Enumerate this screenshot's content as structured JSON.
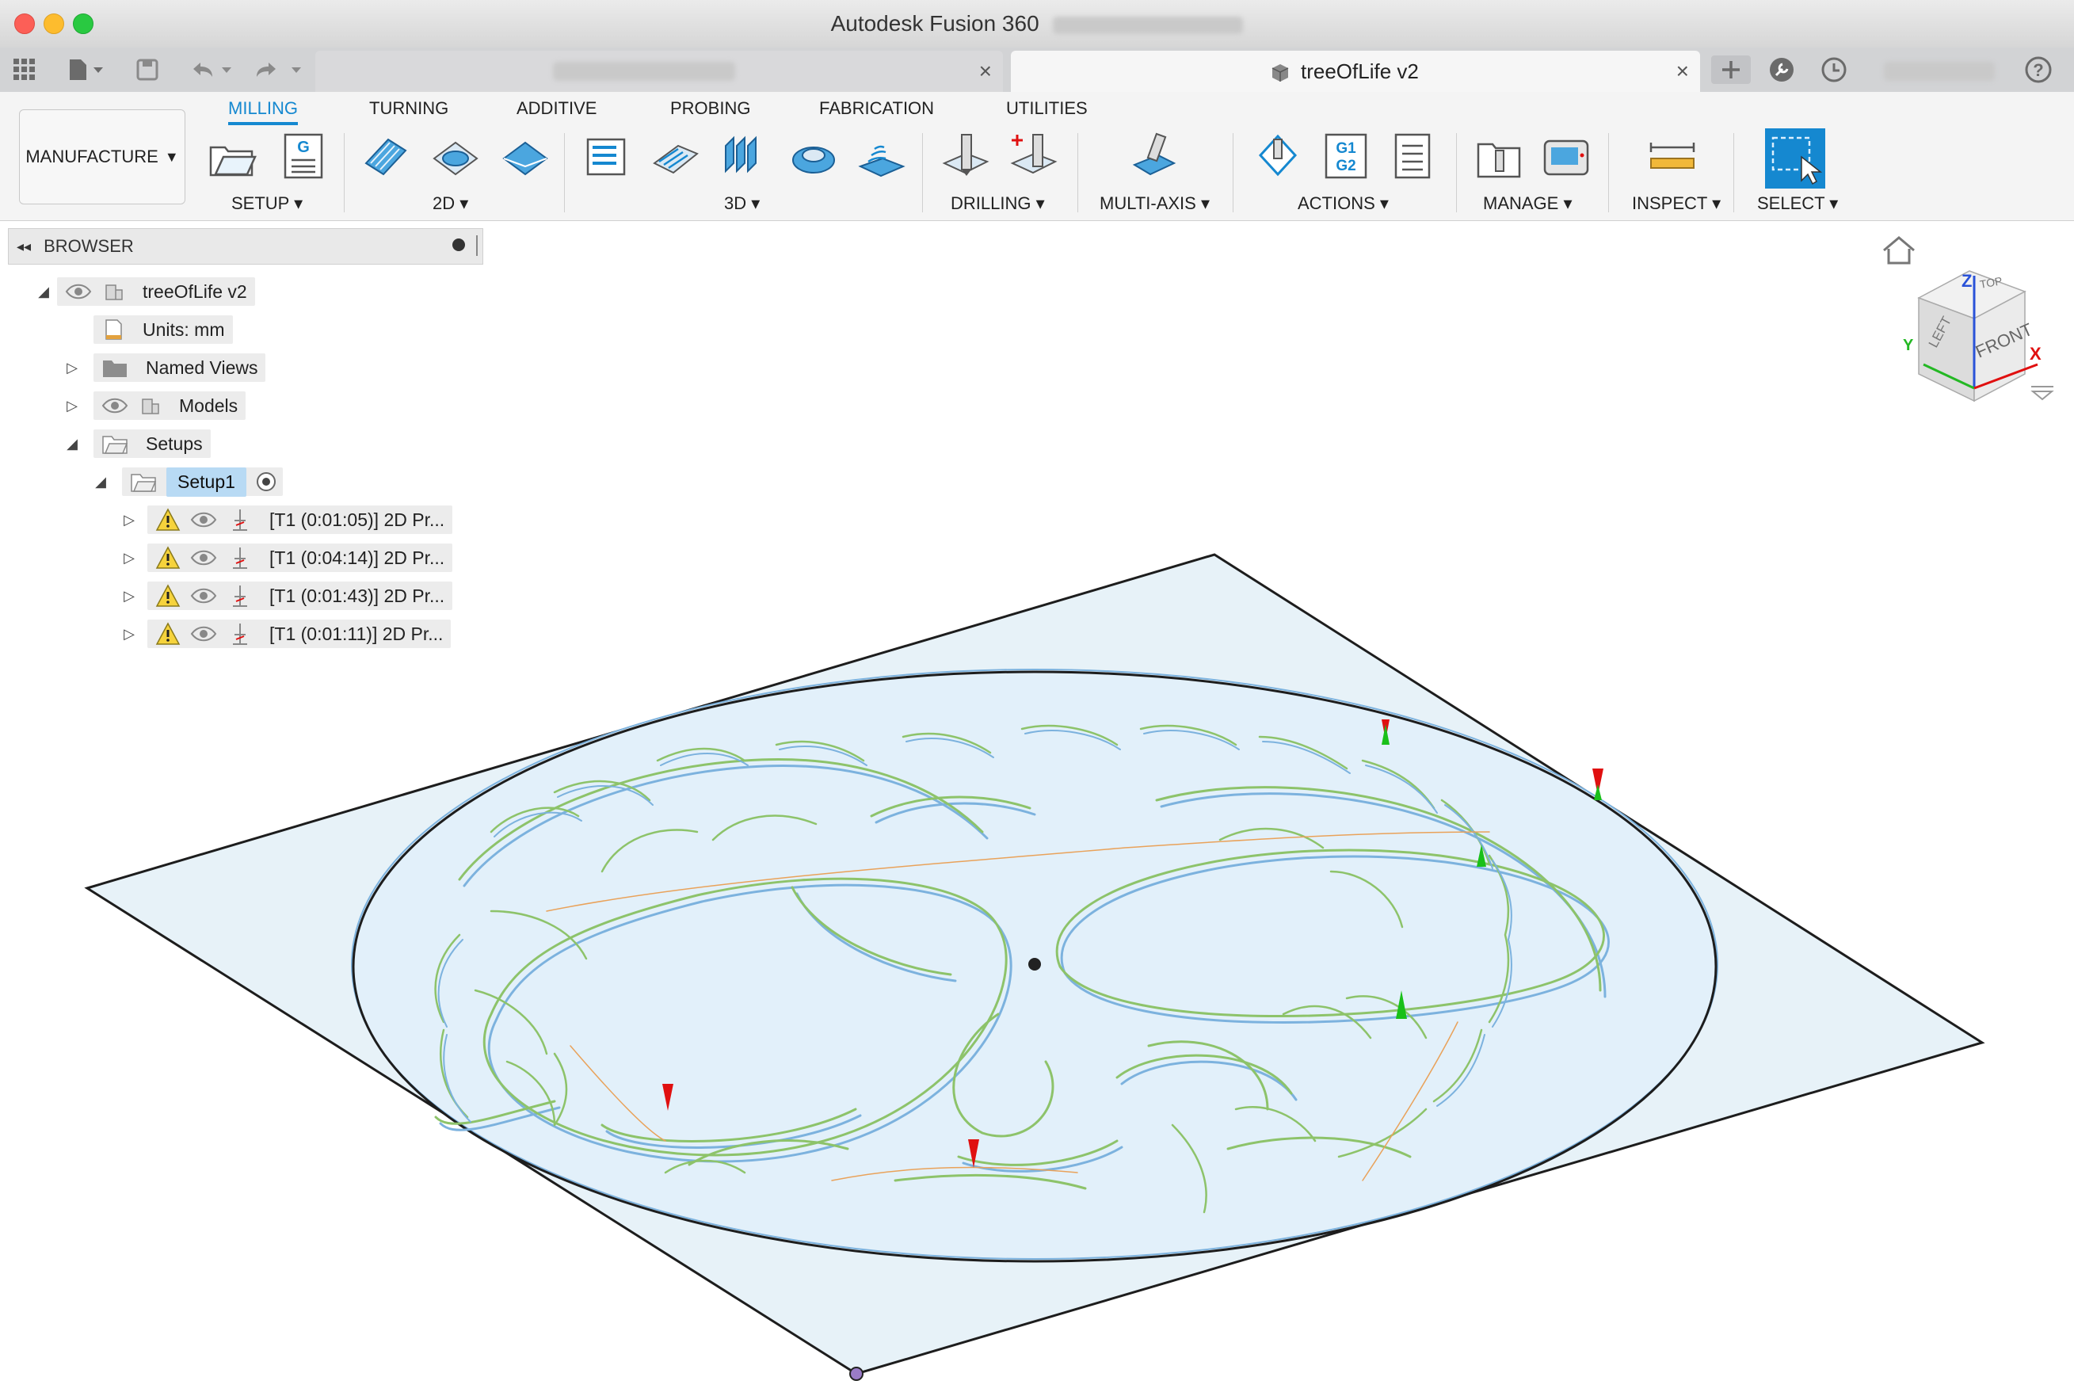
{
  "window": {
    "title": "Autodesk Fusion 360"
  },
  "tabs": [
    {
      "label": ""
    },
    {
      "label": "treeOfLife v2"
    }
  ],
  "workspace": {
    "label": "MANUFACTURE"
  },
  "ribbon": {
    "tabs": [
      "MILLING",
      "TURNING",
      "ADDITIVE",
      "PROBING",
      "FABRICATION",
      "UTILITIES"
    ],
    "groups": [
      "SETUP",
      "2D",
      "3D",
      "DRILLING",
      "MULTI-AXIS",
      "ACTIONS",
      "MANAGE",
      "INSPECT",
      "SELECT"
    ],
    "g1g2_text": [
      "G1",
      "G2"
    ],
    "nc_text": "G"
  },
  "browser": {
    "title": "BROWSER",
    "root": "treeOfLife v2",
    "units": "Units: mm",
    "named_views": "Named Views",
    "models": "Models",
    "setups": "Setups",
    "setup1": "Setup1",
    "operations": [
      "[T1 (0:01:05)] 2D Pr...",
      "[T1 (0:04:14)] 2D Pr...",
      "[T1 (0:01:43)] 2D Pr...",
      "[T1 (0:01:11)] 2D Pr..."
    ]
  },
  "viewcube": {
    "faces": [
      "TOP",
      "LEFT",
      "FRONT"
    ],
    "axes": [
      "Z",
      "Y",
      "X"
    ]
  },
  "colors": {
    "accent": "#1588d0",
    "toolpath_green": "#8dc36a",
    "stock_blue": "#7cb2de",
    "warning": "#f6d33c",
    "marker_red": "#e01010",
    "marker_green": "#19c019"
  }
}
